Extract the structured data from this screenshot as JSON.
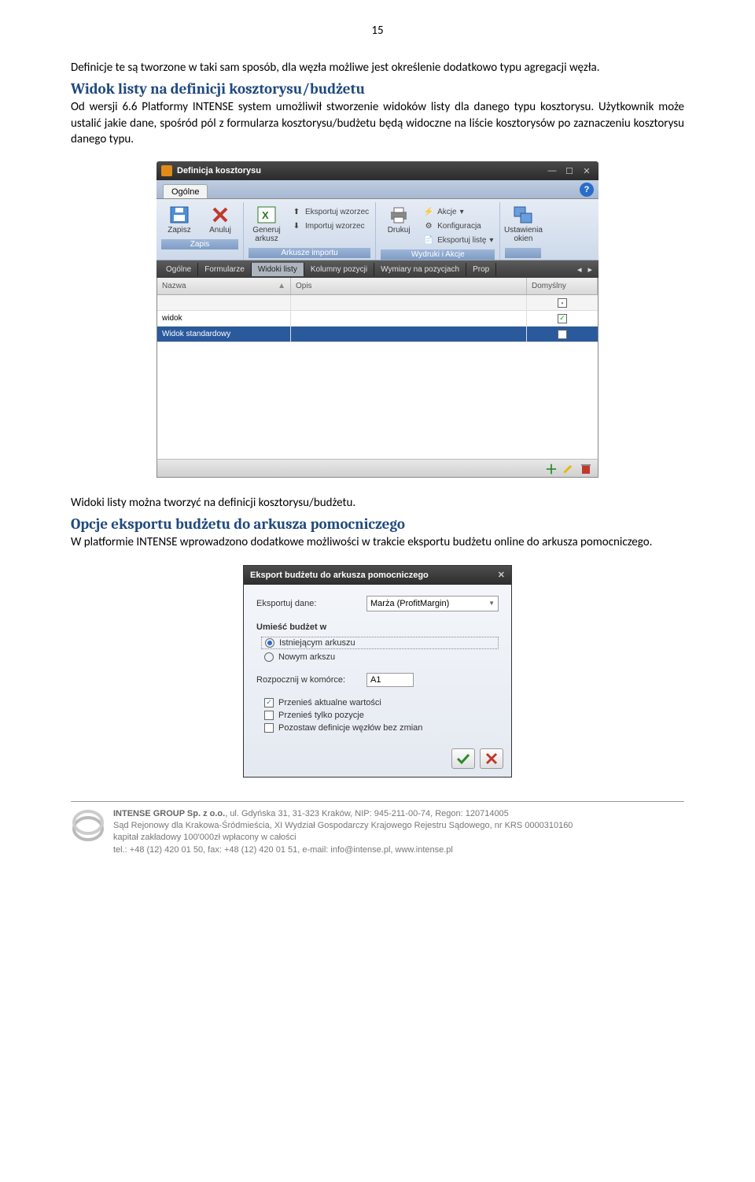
{
  "pageNumber": "15",
  "para1": "Definicje te są tworzone w taki sam sposób, dla  węzła możliwe jest określenie dodatkowo typu agregacji węzła.",
  "heading1": "Widok listy na definicji kosztorysu/budżetu",
  "para2": "Od wersji 6.6 Platformy INTENSE system umożliwił stworzenie widoków listy dla danego typu kosztorysu. Użytkownik może ustalić jakie dane, spośród pól z formularza kosztorysu/budżetu  będą widoczne na liście kosztorysów po zaznaczeniu kosztorysu danego typu.",
  "win1": {
    "title": "Definicja kosztorysu",
    "topTab": "Ogólne",
    "ribbon": {
      "zapis": {
        "save": "Zapisz",
        "cancel": "Anuluj",
        "group": "Zapis"
      },
      "arkusze": {
        "generuj": "Generuj arkusz",
        "eksport": "Eksportuj wzorzec",
        "import": "Importuj wzorzec",
        "group": "Arkusze importu"
      },
      "wydruki": {
        "drukuj": "Drukuj",
        "akcje": "Akcje",
        "konfig": "Konfiguracja",
        "eksportuj": "Eksportuj listę",
        "group": "Wydruki i Akcje"
      },
      "ustaw": {
        "label": "Ustawienia okien"
      }
    },
    "subtabs": [
      "Ogólne",
      "Formularze",
      "Widoki listy",
      "Kolumny pozycji",
      "Wymiary na pozycjach",
      "Prop"
    ],
    "columns": {
      "nazwa": "Nazwa",
      "opis": "Opis",
      "domyslny": "Domyślny"
    },
    "rows": [
      {
        "name": "",
        "checked": false,
        "filter": true
      },
      {
        "name": "widok",
        "checked": true
      },
      {
        "name": "Widok standardowy",
        "checked": false,
        "selected": true
      }
    ]
  },
  "para3": "Widoki listy można tworzyć na definicji kosztorysu/budżetu.",
  "heading2": "Opcje eksportu budżetu do arkusza pomocniczego",
  "para4": "W platformie INTENSE wprowadzono dodatkowe możliwości w trakcie eksportu budżetu online do arkusza pomocniczego.",
  "win2": {
    "title": "Eksport budżetu do arkusza pomocniczego",
    "eksportujDane": "Eksportuj dane:",
    "ddValue": "Marża (ProfitMargin)",
    "umiesc": "Umieść budżet w",
    "radio1": "Istniejącym arkuszu",
    "radio2": "Nowym arkszu",
    "rozpocznij": "Rozpocznij w komórce:",
    "cellValue": "A1",
    "chk1": "Przenieś aktualne wartości",
    "chk2": "Przenieś tylko pozycje",
    "chk3": "Pozostaw definicje węzłów bez zmian"
  },
  "footer": {
    "l1a": "INTENSE GROUP  Sp. z o.o.",
    "l1b": ", ul. Gdyńska 31, 31-323 Kraków, NIP: 945-211-00-74, Regon: 120714005",
    "l2": "Sąd Rejonowy dla Krakowa-Śródmieścia, XI Wydział Gospodarczy Krajowego Rejestru Sądowego, nr KRS 0000310160",
    "l3": "kapitał zakładowy 100'000zł wpłacony w całości",
    "l4": "tel.: +48 (12) 420 01 50, fax: +48 (12) 420 01 51, e-mail: info@intense.pl, www.intense.pl"
  }
}
